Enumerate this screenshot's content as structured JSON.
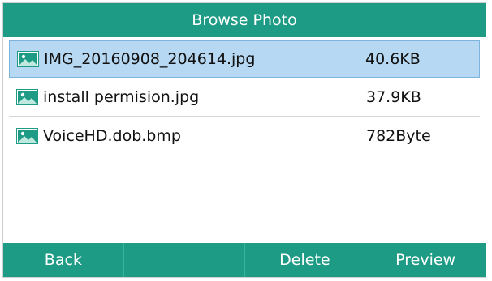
{
  "title": "Browse Photo",
  "files": [
    {
      "name": "IMG_20160908_204614.jpg",
      "size": "40.6KB",
      "icon": "image-icon",
      "selected": true
    },
    {
      "name": "install permision.jpg",
      "size": "37.9KB",
      "icon": "image-icon",
      "selected": false
    },
    {
      "name": "VoiceHD.dob.bmp",
      "size": "782Byte",
      "icon": "image-icon",
      "selected": false
    }
  ],
  "softkeys": [
    {
      "label": "Back"
    },
    {
      "label": ""
    },
    {
      "label": "Delete"
    },
    {
      "label": "Preview"
    }
  ],
  "colors": {
    "accent": "#1d9b84",
    "selection": "#b6d8f3"
  }
}
